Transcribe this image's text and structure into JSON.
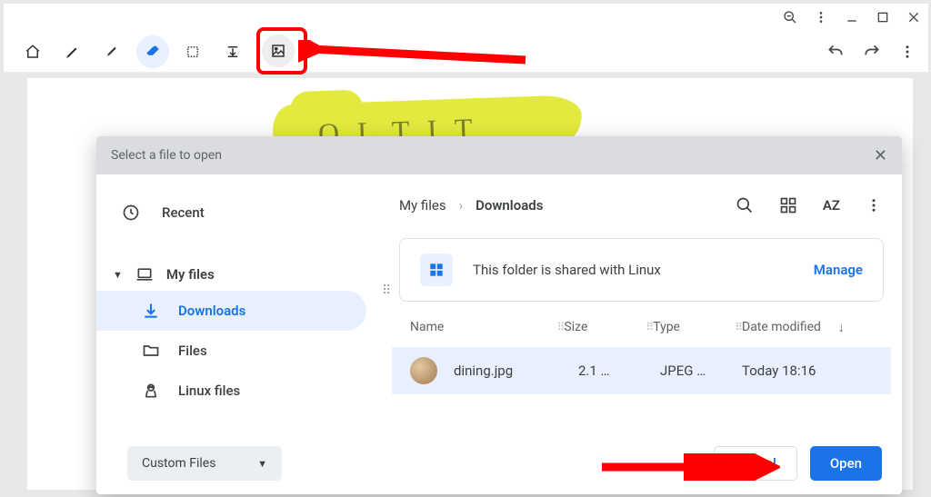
{
  "app": {
    "scribble": "O L T I T"
  },
  "dialog": {
    "title": "Select a file to open",
    "recent": "Recent",
    "my_files": "My files",
    "nav": {
      "downloads": "Downloads",
      "files": "Files",
      "linux": "Linux files"
    },
    "breadcrumb": {
      "root": "My files",
      "current": "Downloads"
    },
    "banner": {
      "text": "This folder is shared with Linux",
      "manage": "Manage"
    },
    "headers": {
      "name": "Name",
      "size": "Size",
      "type": "Type",
      "date": "Date modified"
    },
    "file": {
      "name": "dining.jpg",
      "size": "2.1 …",
      "type": "JPEG …",
      "date": "Today 18:16"
    },
    "footer": {
      "filetype": "Custom Files",
      "cancel": "Cancel",
      "open": "Open"
    }
  }
}
